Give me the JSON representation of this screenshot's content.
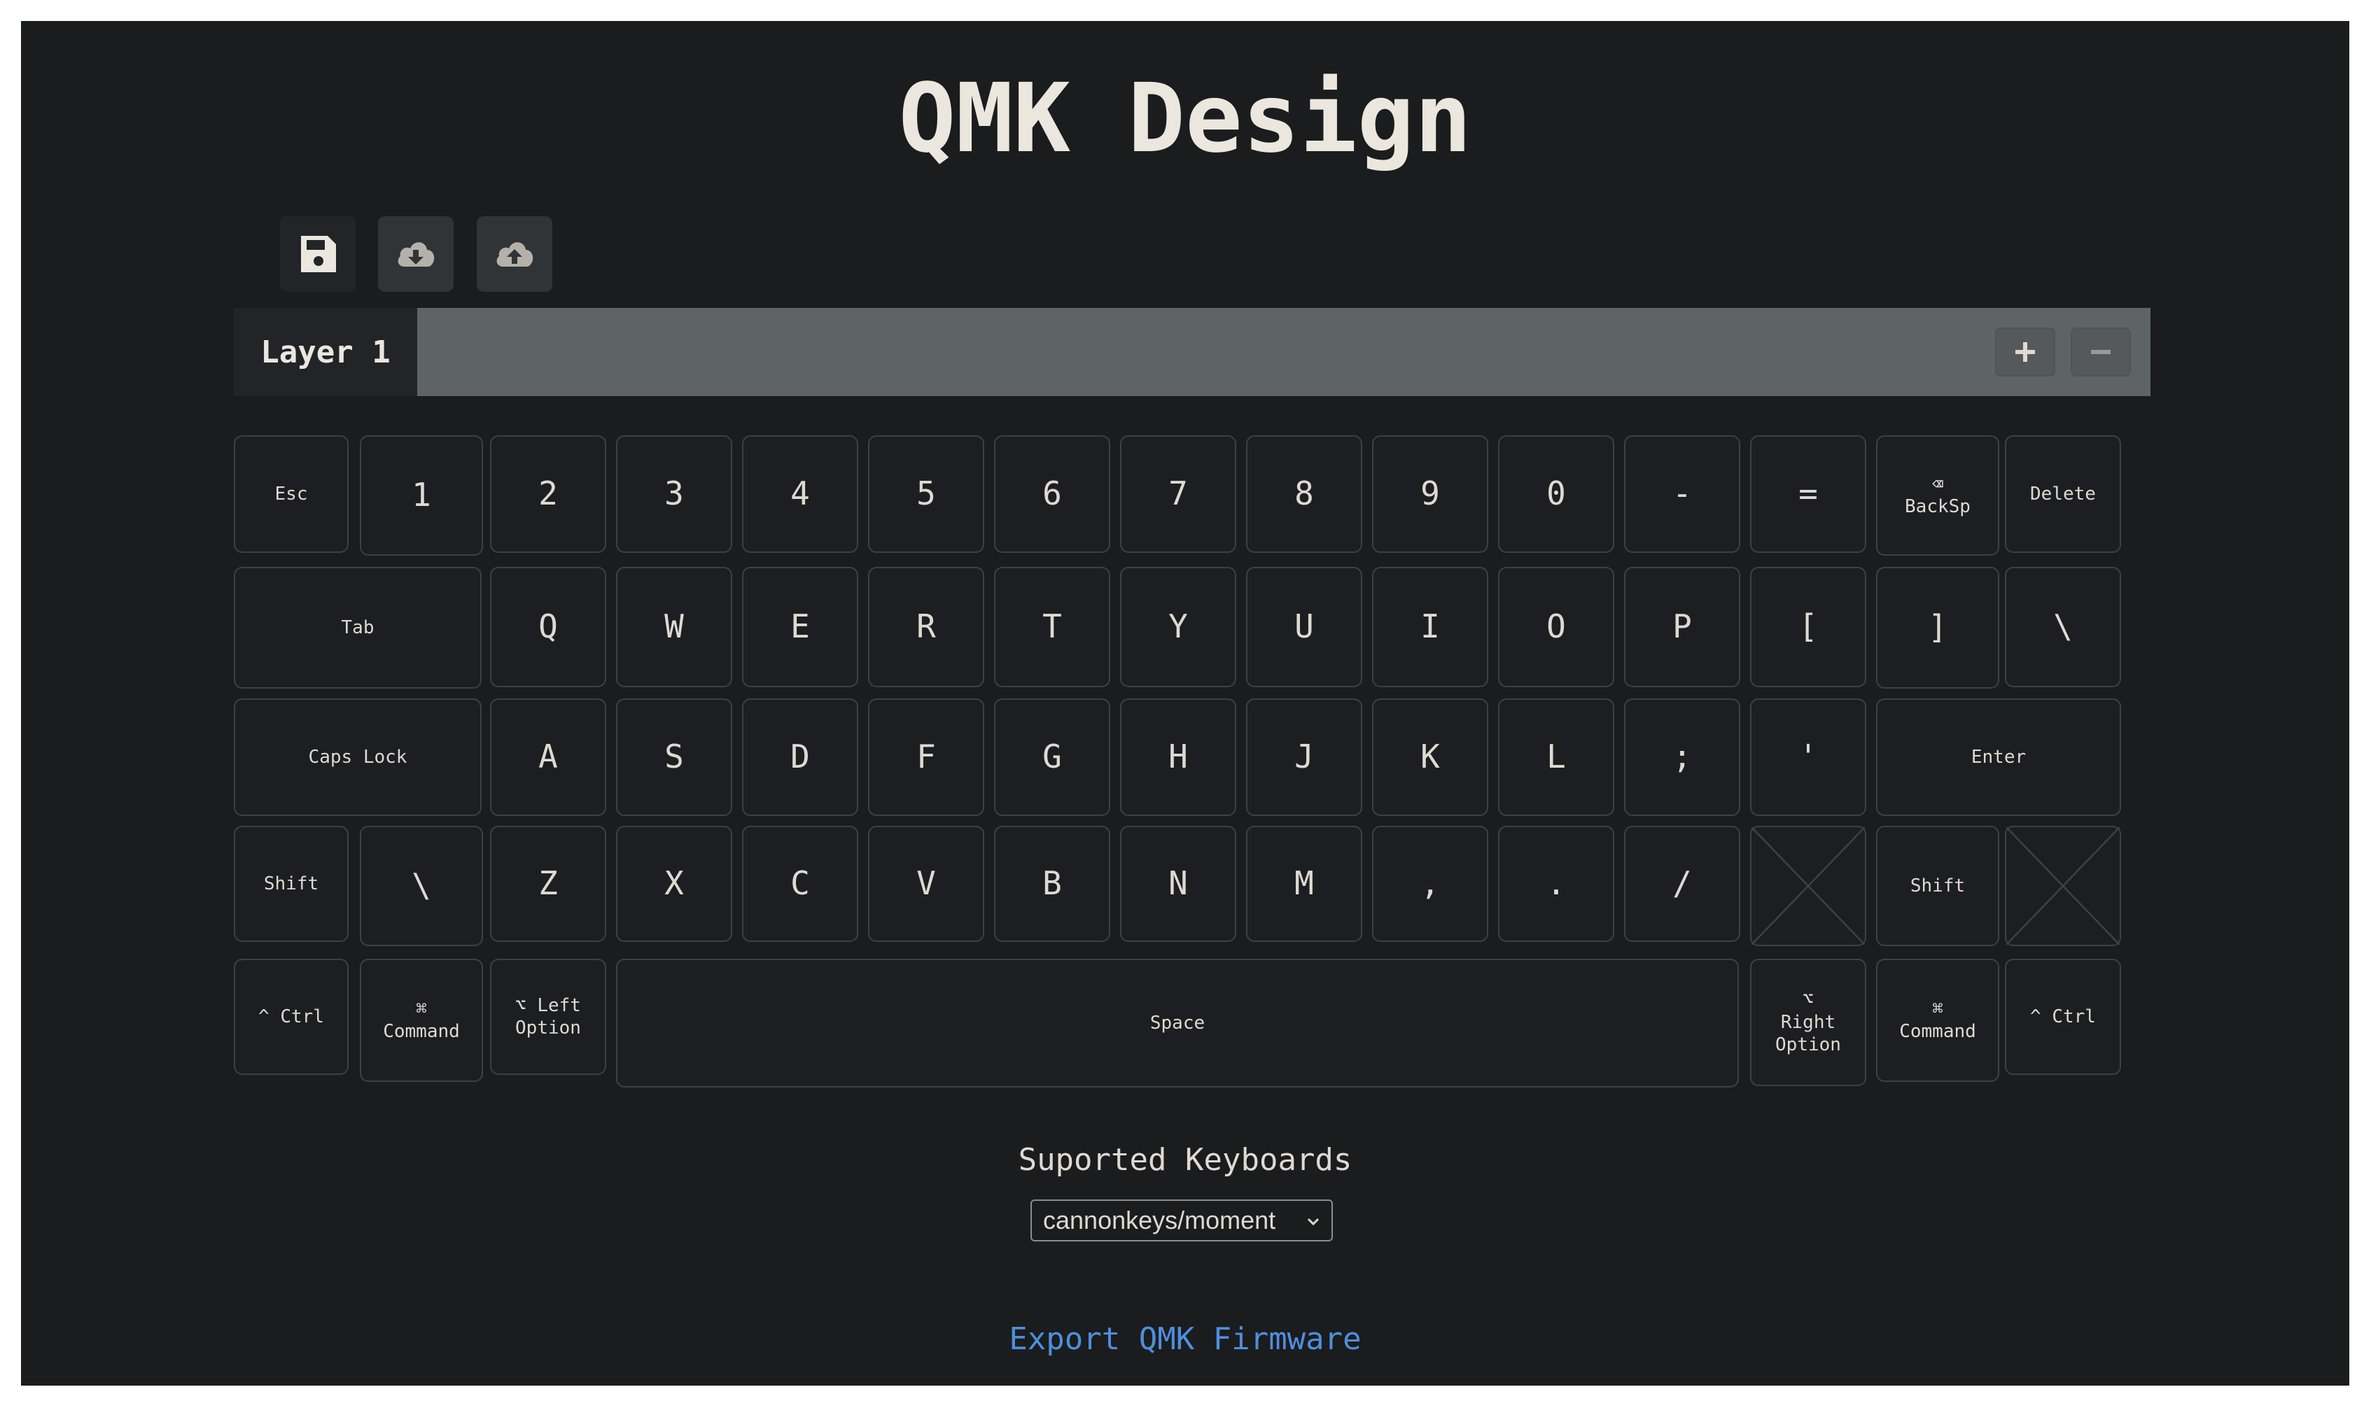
{
  "app": {
    "title": "QMK Design"
  },
  "toolbar": {
    "buttons": [
      {
        "name": "save-button",
        "icon": "floppy-disk-icon"
      },
      {
        "name": "download-button",
        "icon": "cloud-download-icon"
      },
      {
        "name": "upload-button",
        "icon": "cloud-upload-icon"
      }
    ]
  },
  "layers": {
    "tabs": [
      {
        "label": "Layer 1",
        "active": true
      }
    ],
    "add_icon": "plus-icon",
    "remove_icon": "minus-icon"
  },
  "keyboard": {
    "keys": [
      {
        "label": "Esc",
        "name": "key-esc"
      },
      {
        "label": "1",
        "name": "key-1"
      },
      {
        "label": "2",
        "name": "key-2"
      },
      {
        "label": "3",
        "name": "key-3"
      },
      {
        "label": "4",
        "name": "key-4"
      },
      {
        "label": "5",
        "name": "key-5"
      },
      {
        "label": "6",
        "name": "key-6"
      },
      {
        "label": "7",
        "name": "key-7"
      },
      {
        "label": "8",
        "name": "key-8"
      },
      {
        "label": "9",
        "name": "key-9"
      },
      {
        "label": "0",
        "name": "key-0"
      },
      {
        "label": "-",
        "name": "key-minus"
      },
      {
        "label": "=",
        "name": "key-equal"
      },
      {
        "symbol": "⌫",
        "label": "BackSp",
        "name": "key-backspace"
      },
      {
        "label": "Delete",
        "name": "key-delete"
      },
      {
        "label": "Tab",
        "name": "key-tab"
      },
      {
        "label": "Q",
        "name": "key-q"
      },
      {
        "label": "W",
        "name": "key-w"
      },
      {
        "label": "E",
        "name": "key-e"
      },
      {
        "label": "R",
        "name": "key-r"
      },
      {
        "label": "T",
        "name": "key-t"
      },
      {
        "label": "Y",
        "name": "key-y"
      },
      {
        "label": "U",
        "name": "key-u"
      },
      {
        "label": "I",
        "name": "key-i"
      },
      {
        "label": "O",
        "name": "key-o"
      },
      {
        "label": "P",
        "name": "key-p"
      },
      {
        "label": "[",
        "name": "key-left-bracket"
      },
      {
        "label": "]",
        "name": "key-right-bracket"
      },
      {
        "label": "\\",
        "name": "key-backslash"
      },
      {
        "label": "Caps Lock",
        "name": "key-caps-lock"
      },
      {
        "label": "A",
        "name": "key-a"
      },
      {
        "label": "S",
        "name": "key-s"
      },
      {
        "label": "D",
        "name": "key-d"
      },
      {
        "label": "F",
        "name": "key-f"
      },
      {
        "label": "G",
        "name": "key-g"
      },
      {
        "label": "H",
        "name": "key-h"
      },
      {
        "label": "J",
        "name": "key-j"
      },
      {
        "label": "K",
        "name": "key-k"
      },
      {
        "label": "L",
        "name": "key-l"
      },
      {
        "label": ";",
        "name": "key-semicolon"
      },
      {
        "label": "'",
        "name": "key-quote"
      },
      {
        "label": "Enter",
        "name": "key-enter"
      },
      {
        "label": "Shift",
        "name": "key-left-shift"
      },
      {
        "label": "\\",
        "name": "key-iso-backslash"
      },
      {
        "label": "Z",
        "name": "key-z"
      },
      {
        "label": "X",
        "name": "key-x"
      },
      {
        "label": "C",
        "name": "key-c"
      },
      {
        "label": "V",
        "name": "key-v"
      },
      {
        "label": "B",
        "name": "key-b"
      },
      {
        "label": "N",
        "name": "key-n"
      },
      {
        "label": "M",
        "name": "key-m"
      },
      {
        "label": ",",
        "name": "key-comma"
      },
      {
        "label": ".",
        "name": "key-period"
      },
      {
        "label": "/",
        "name": "key-slash"
      },
      {
        "label": "",
        "name": "key-empty-1",
        "empty": true
      },
      {
        "label": "Shift",
        "name": "key-right-shift"
      },
      {
        "label": "",
        "name": "key-empty-2",
        "empty": true
      },
      {
        "label": "^ Ctrl",
        "name": "key-left-ctrl"
      },
      {
        "symbol": "⌘",
        "label": "Command",
        "name": "key-left-command"
      },
      {
        "label": "⌥ Left Option",
        "name": "key-left-option"
      },
      {
        "label": "Space",
        "name": "key-space"
      },
      {
        "symbol": "⌥",
        "label": "Right Option",
        "name": "key-right-option"
      },
      {
        "symbol": "⌘",
        "label": "Command",
        "name": "key-right-command"
      },
      {
        "label": "^ Ctrl",
        "name": "key-right-ctrl"
      }
    ]
  },
  "supported": {
    "label": "Suported Keyboards",
    "selected": "cannonkeys/moment"
  },
  "export": {
    "label": "Export QMK Firmware"
  }
}
